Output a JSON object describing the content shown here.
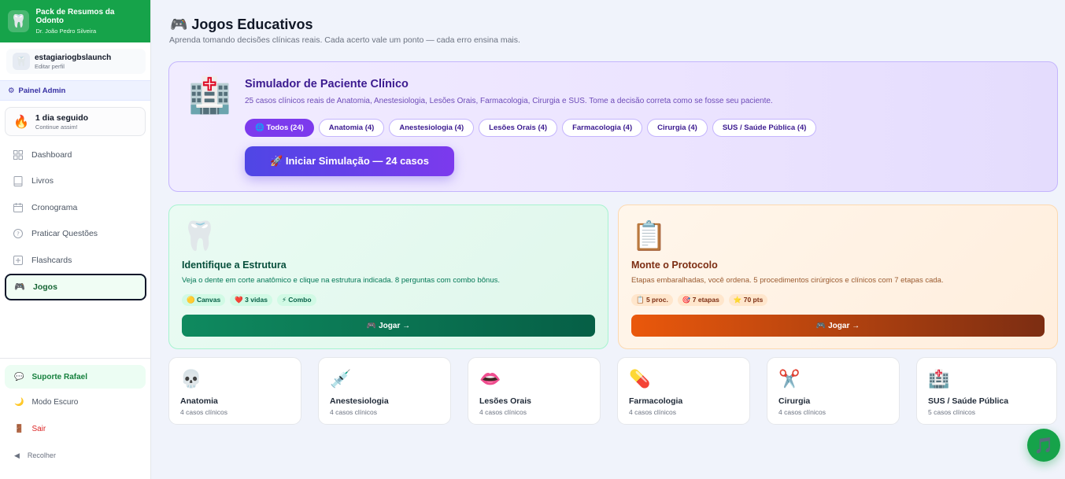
{
  "brand": {
    "title": "Pack de Resumos da Odonto",
    "subtitle": "Dr. João Pedro Silveira",
    "icon": "tooth-icon"
  },
  "profile": {
    "name": "estagiariogbslaunch",
    "edit_label": "Editar perfil"
  },
  "admin": {
    "label": "Painel Admin"
  },
  "streak": {
    "title": "1 dia seguido",
    "subtitle": "Continue assim!"
  },
  "nav": [
    {
      "label": "Dashboard",
      "icon": "grid-icon"
    },
    {
      "label": "Livros",
      "icon": "book-icon"
    },
    {
      "label": "Cronograma",
      "icon": "calendar-icon"
    },
    {
      "label": "Praticar Questões",
      "icon": "question-icon"
    },
    {
      "label": "Flashcards",
      "icon": "plus-square-icon"
    },
    {
      "label": "Jogos",
      "icon": "gamepad-icon",
      "active": true
    }
  ],
  "bottom": {
    "support": "Suporte Rafael",
    "dark_mode": "Modo Escuro",
    "logout": "Sair",
    "collapse": "Recolher"
  },
  "page": {
    "title": "🎮 Jogos Educativos",
    "subtitle": "Aprenda tomando decisões clínicas reais. Cada acerto vale um ponto — cada erro ensina mais."
  },
  "simulator": {
    "title": "Simulador de Paciente Clínico",
    "description": "25 casos clínicos reais de Anatomia, Anestesiologia, Lesões Orais, Farmacologia, Cirurgia e SUS. Tome a decisão correta como se fosse seu paciente.",
    "chips": [
      "🌐 Todos (24)",
      "Anatomia (4)",
      "Anestesiologia (4)",
      "Lesões Orais (4)",
      "Farmacologia (4)",
      "Cirurgia (4)",
      "SUS / Saúde Pública (4)"
    ],
    "button": "🚀 Iniciar Simulação — 24 casos"
  },
  "games": [
    {
      "title": "Identifique a Estrutura",
      "description": "Veja o dente em corte anatômico e clique na estrutura indicada. 8 perguntas com combo bônus.",
      "tags": [
        "🟡 Canvas",
        "❤️ 3 vidas",
        "⚡ Combo"
      ],
      "button": "🎮 Jogar →"
    },
    {
      "title": "Monte o Protocolo",
      "description": "Etapas embaralhadas, você ordena. 5 procedimentos cirúrgicos e clínicos com 7 etapas cada.",
      "tags": [
        "📋 5 proc.",
        "🎯 7 etapas",
        "⭐ 70 pts"
      ],
      "button": "🎮 Jogar →"
    }
  ],
  "categories": [
    {
      "name": "Anatomia",
      "count": "4 casos clínicos",
      "icon": "skull-icon"
    },
    {
      "name": "Anestesiologia",
      "count": "4 casos clínicos",
      "icon": "syringe-icon"
    },
    {
      "name": "Lesões Orais",
      "count": "4 casos clínicos",
      "icon": "lips-icon"
    },
    {
      "name": "Farmacologia",
      "count": "4 casos clínicos",
      "icon": "pill-icon"
    },
    {
      "name": "Cirurgia",
      "count": "4 casos clínicos",
      "icon": "scissors-icon"
    },
    {
      "name": "SUS / Saúde Pública",
      "count": "5 casos clínicos",
      "icon": "hospital-icon"
    }
  ],
  "colors": {
    "brand_green": "#16a34a",
    "accent_purple": "#7c3aed",
    "accent_orange": "#ea580c"
  }
}
